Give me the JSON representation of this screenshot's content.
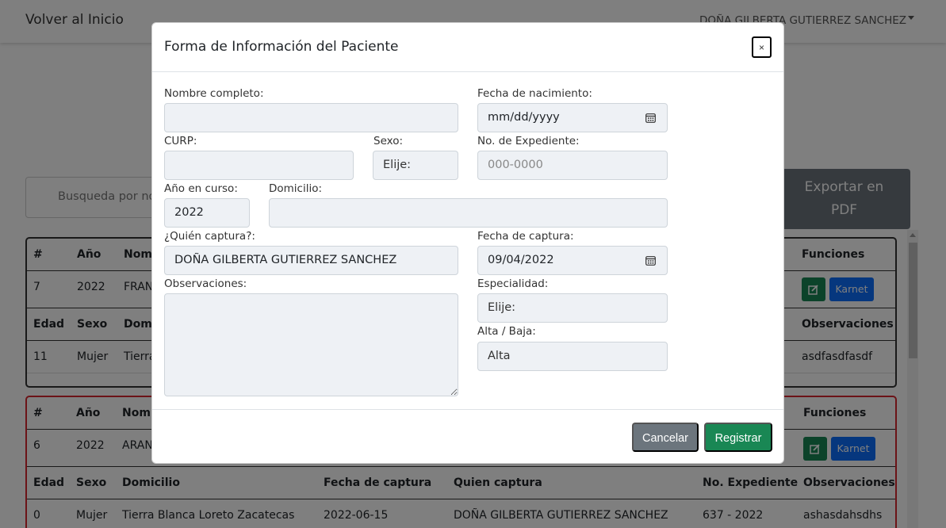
{
  "navbar": {
    "home_label": "Volver al Inicio",
    "user_name": "DOÑA GILBERTA GUTIERREZ SANCHEZ"
  },
  "search": {
    "placeholder": "Busqueda por no"
  },
  "export_button": {
    "line1": "Exportar en",
    "line2": "PDF"
  },
  "record1": {
    "header1": [
      "#",
      "Año",
      "Nomb",
      "Funciones"
    ],
    "row1": [
      "7",
      "2022",
      "FRAN"
    ],
    "header2": [
      "Edad",
      "Sexo",
      "Domi",
      "Observaciones"
    ],
    "row2": [
      "11",
      "Mujer",
      "Tierra",
      "asdfasdfasdf"
    ],
    "karnet_label": "Karnet"
  },
  "record2": {
    "header1": [
      "#",
      "Año",
      "Nomb",
      "Funciones"
    ],
    "row1": [
      "6",
      "2022",
      "ARAN"
    ],
    "header2": [
      "Edad",
      "Sexo",
      "Domicilio",
      "Fecha de captura",
      "Quien captura",
      "No. Expediente",
      "Observaciones"
    ],
    "row2": [
      "0",
      "Mujer",
      "Tierra Blanca Loreto Zacatecas",
      "2022-06-15",
      "DOÑA GILBERTA GUTIERREZ SANCHEZ",
      "637 - 2022",
      "ashasdahsdhs"
    ],
    "karnet_label": "Karnet"
  },
  "modal": {
    "title": "Forma de Información del Paciente",
    "close_label": "×",
    "fields": {
      "nombre": {
        "label": "Nombre completo:",
        "value": ""
      },
      "fecha_nacimiento": {
        "label": "Fecha de nacimiento:",
        "value": "mm/dd/yyyy"
      },
      "curp": {
        "label": "CURP:",
        "value": ""
      },
      "sexo": {
        "label": "Sexo:",
        "value": "Elije:"
      },
      "expediente": {
        "label": "No. de Expediente:",
        "placeholder": "000-0000"
      },
      "anio": {
        "label": "Año en curso:",
        "value": "2022"
      },
      "domicilio": {
        "label": "Domicilio:",
        "value": ""
      },
      "quien_captura": {
        "label": "¿Quién captura?:",
        "value": "DOÑA GILBERTA GUTIERREZ SANCHEZ"
      },
      "fecha_captura": {
        "label": "Fecha de captura:",
        "value": "09/04/2022"
      },
      "observaciones": {
        "label": "Observaciones:",
        "value": ""
      },
      "especialidad": {
        "label": "Especialidad:",
        "value": "Elije:"
      },
      "alta_baja": {
        "label": "Alta / Baja:",
        "value": "Alta"
      }
    },
    "cancel_label": "Cancelar",
    "submit_label": "Registrar"
  },
  "colors": {
    "success": "#198754",
    "primary": "#0d6efd",
    "secondary": "#6c757d",
    "danger": "#d9262f"
  }
}
